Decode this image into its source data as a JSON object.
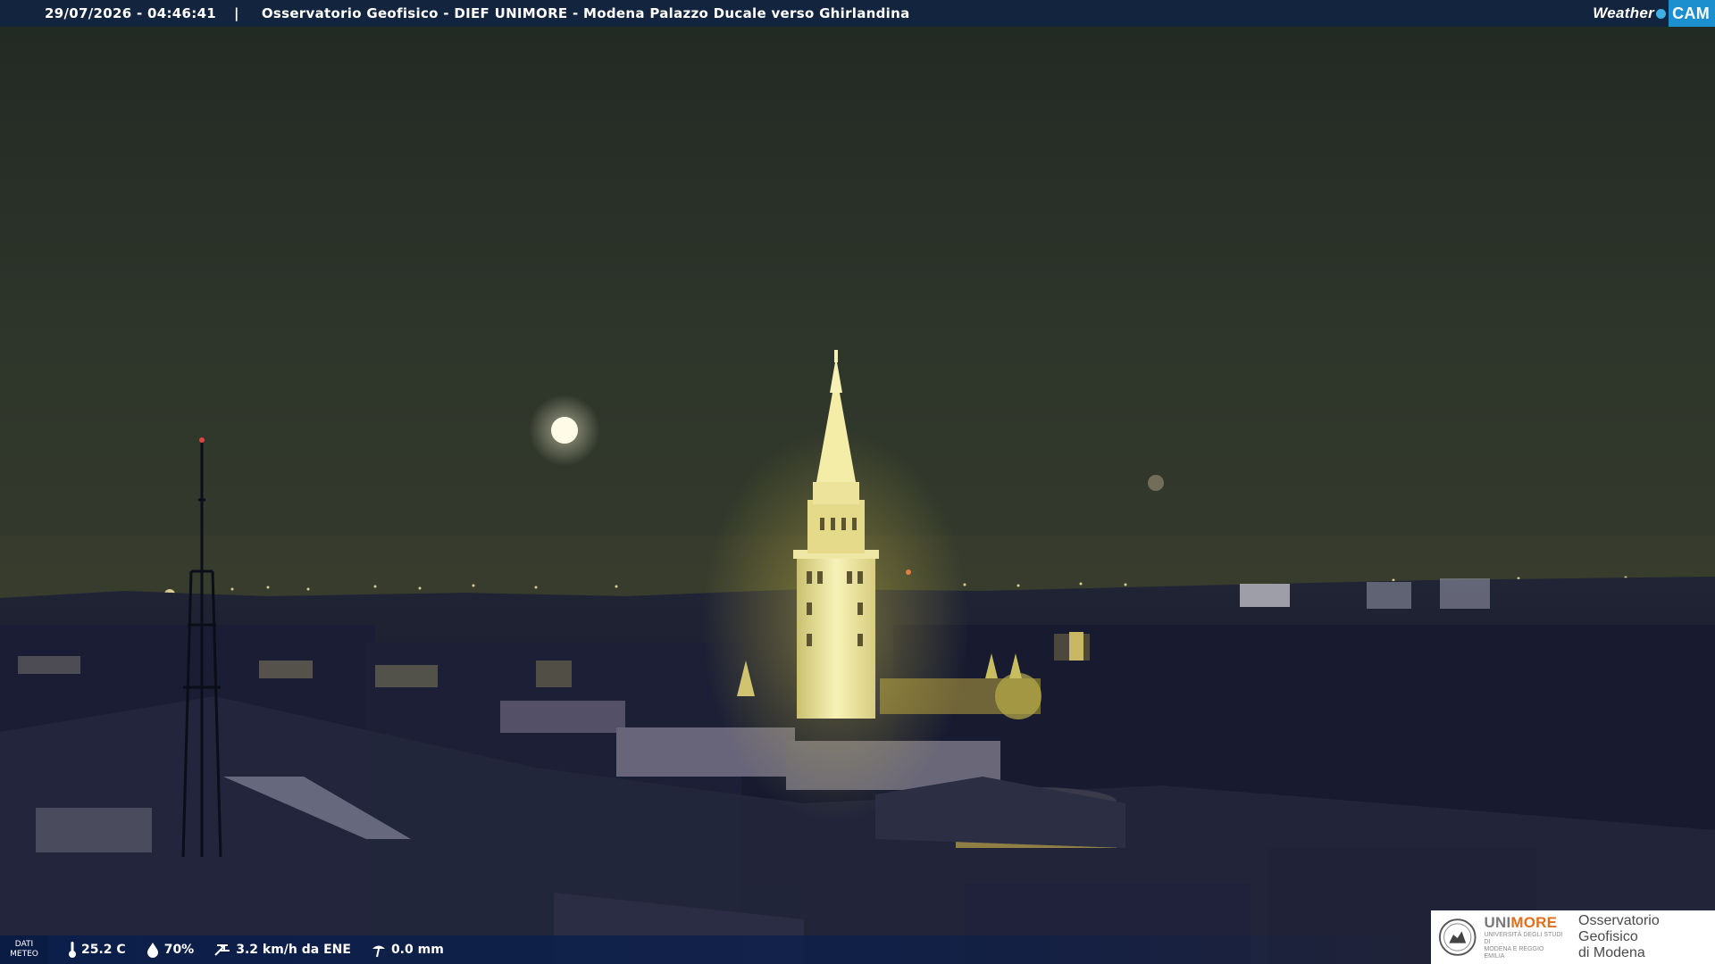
{
  "header": {
    "datetime": "29/07/2026 - 04:46:41",
    "separator": "|",
    "title": "Osservatorio Geofisico - DIEF UNIMORE - Modena Palazzo Ducale verso Ghirlandina",
    "brand_weather": "Weather",
    "brand_cam": "CAM"
  },
  "meteo": {
    "dati_line1": "DATI",
    "dati_line2": "METEO",
    "temperature": "25.2 C",
    "humidity": "70%",
    "wind": "3.2 km/h da ENE",
    "rain": "0.0 mm"
  },
  "logo": {
    "unimore_1": "UNI",
    "unimore_2": "MORE",
    "unimore_sub1": "UNIVERSITÀ DEGLI STUDI DI",
    "unimore_sub2": "MODENA E REGGIO EMILIA",
    "osservatorio_1": "Osservatorio Geofisico",
    "osservatorio_2": "di Modena"
  },
  "icons": {
    "temperature": "thermometer-icon",
    "humidity": "humidity-drop-icon",
    "wind": "wind-icon",
    "rain": "rain-gauge-icon"
  },
  "colors": {
    "topbar": "#13243f",
    "brand_cam": "#1c8fcf",
    "unimore_orange": "#e0701f",
    "tower_light": "#f3ec9a"
  }
}
